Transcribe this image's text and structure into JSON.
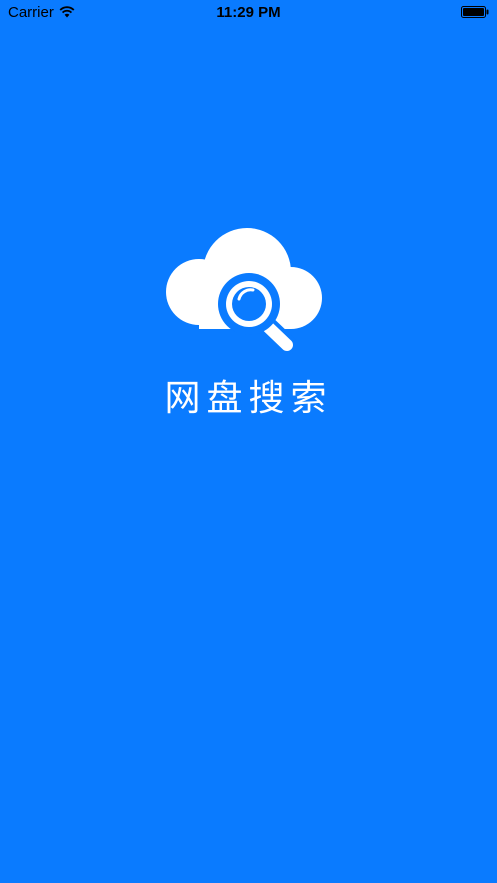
{
  "status_bar": {
    "carrier": "Carrier",
    "time": "11:29 PM",
    "wifi_icon": "wifi-icon",
    "battery_icon": "battery-icon"
  },
  "splash": {
    "logo_icon": "cloud-search-icon",
    "app_name": "网盘搜索"
  },
  "colors": {
    "background": "#0a7bff",
    "foreground": "#ffffff"
  }
}
